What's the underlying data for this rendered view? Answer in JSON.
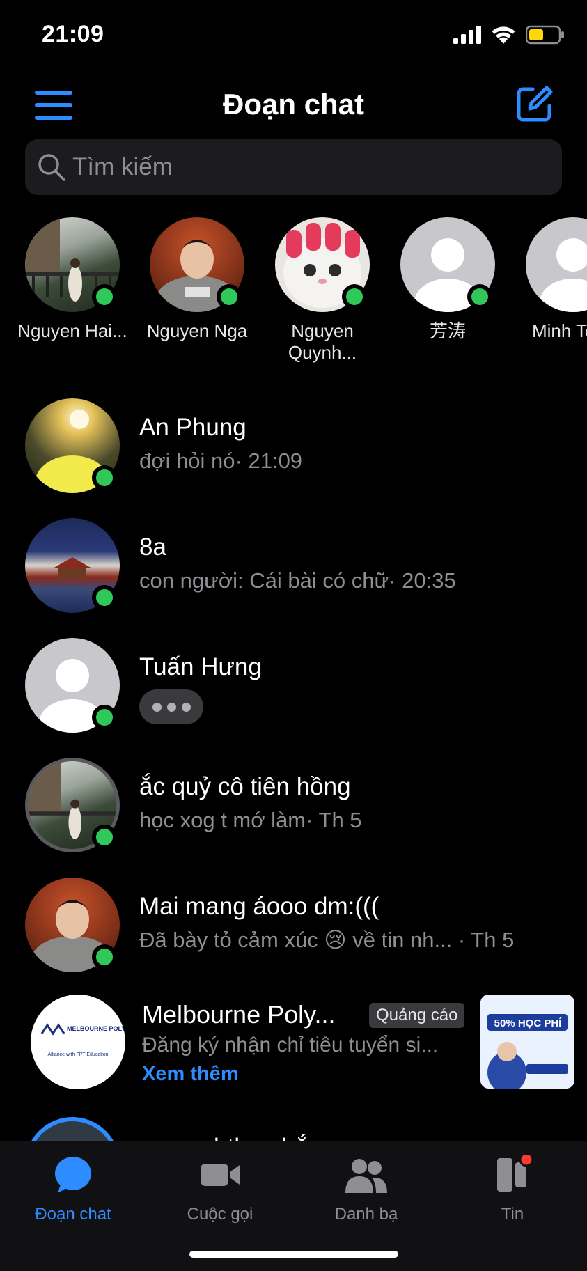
{
  "status_bar": {
    "time": "21:09"
  },
  "header": {
    "title": "Đoạn chat"
  },
  "search": {
    "placeholder": "Tìm kiếm"
  },
  "stories": [
    {
      "name": "Nguyen Hai..."
    },
    {
      "name": "Nguyen Nga"
    },
    {
      "name": "Nguyen Quynh..."
    },
    {
      "name": "芳涛"
    },
    {
      "name": "Minh Teco"
    }
  ],
  "chats": [
    {
      "name": "An Phung",
      "preview": "đợi hỏi nó· 21:09"
    },
    {
      "name": "8a",
      "preview": "con người: Cái bài có chữ· 20:35"
    },
    {
      "name": "Tuấn Hưng",
      "preview": ""
    },
    {
      "name": "ắc quỷ cô tiên hồng",
      "preview": "học xog t mớ làm· Th 5"
    },
    {
      "name": "Mai mang áooo dm:(((",
      "preview": "Đã bày tỏ cảm xúc 😢 về tin nh... · Th 5"
    }
  ],
  "ad": {
    "name": "Melbourne Poly...",
    "badge": "Quảng cáo",
    "description": "Đăng ký nhận chỉ tiêu tuyển si...",
    "more": "Xem thêm",
    "logo_text": "MELBOURNE POLYTECHNIC",
    "logo_sub": "Alliance with FPT Education",
    "thumb_text": "50% HỌC PHÍ"
  },
  "partial_chat": {
    "name": "aaaaa bthu nhắn"
  },
  "tabs": [
    {
      "label": "Đoạn chat",
      "icon": "chat-bubble-icon",
      "active": true
    },
    {
      "label": "Cuộc gọi",
      "icon": "video-camera-icon",
      "active": false
    },
    {
      "label": "Danh bạ",
      "icon": "people-icon",
      "active": false
    },
    {
      "label": "Tin",
      "icon": "stories-icon",
      "active": false
    }
  ],
  "colors": {
    "accent": "#2d8cff",
    "online": "#31c85a",
    "background": "#000000",
    "notification": "#ff3b30"
  }
}
